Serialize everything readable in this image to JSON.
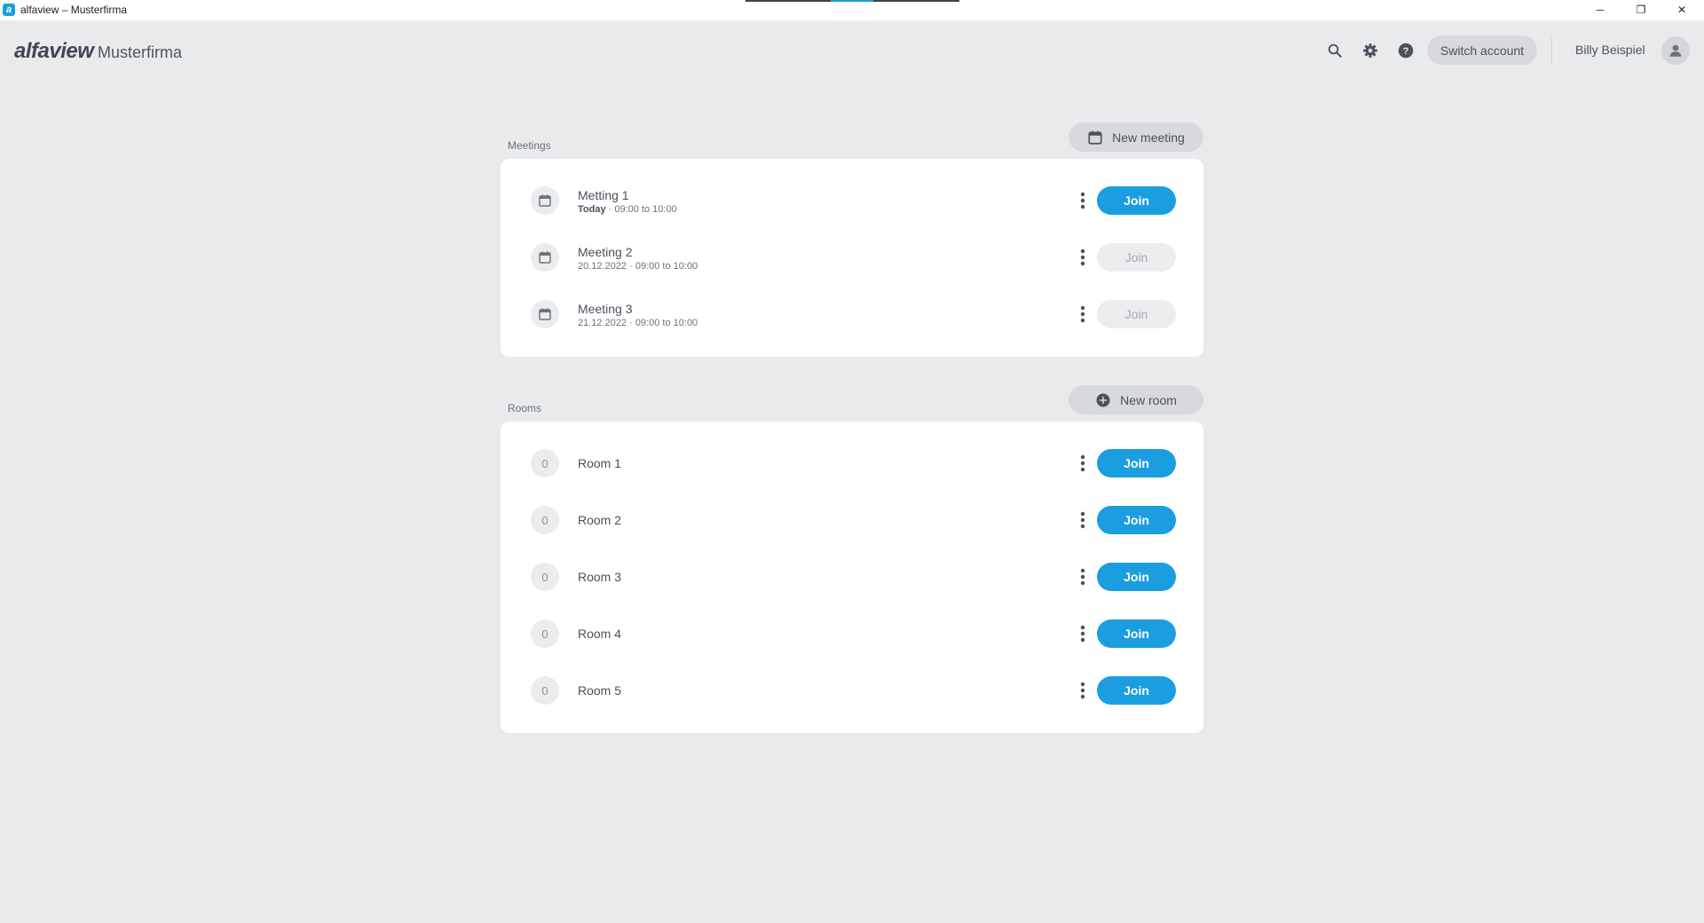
{
  "window": {
    "title": "alfaview – Musterfirma",
    "app_icon_letter": "a",
    "minimize_glyph": "─",
    "maximize_glyph": "❐",
    "close_glyph": "✕"
  },
  "header": {
    "brand": "alfaview",
    "organization": "Musterfirma",
    "switch_account_label": "Switch account",
    "user_name": "Billy Beispiel",
    "icons": [
      "search-icon",
      "gear-icon",
      "help-icon",
      "user-avatar-icon"
    ]
  },
  "meetings": {
    "section_label": "Meetings",
    "new_button_label": "New meeting",
    "items": [
      {
        "title": "Metting 1",
        "date": "Today",
        "time": " · 09:00 to 10:00",
        "join_label": "Join",
        "join_active": true
      },
      {
        "title": "Meeting 2",
        "date": "20.12.2022",
        "time": " · 09:00 to 10:00",
        "join_label": "Join",
        "join_active": false
      },
      {
        "title": "Meeting 3",
        "date": "21.12.2022",
        "time": " · 09:00 to 10:00",
        "join_label": "Join",
        "join_active": false
      }
    ]
  },
  "rooms": {
    "section_label": "Rooms",
    "new_button_label": "New room",
    "items": [
      {
        "title": "Room 1",
        "count": "0",
        "join_label": "Join"
      },
      {
        "title": "Room 2",
        "count": "0",
        "join_label": "Join"
      },
      {
        "title": "Room 3",
        "count": "0",
        "join_label": "Join"
      },
      {
        "title": "Room 4",
        "count": "0",
        "join_label": "Join"
      },
      {
        "title": "Room 5",
        "count": "0",
        "join_label": "Join"
      }
    ]
  },
  "colors": {
    "accent": "#1a9ee0",
    "background": "#e9eaec",
    "card": "#ffffff"
  }
}
